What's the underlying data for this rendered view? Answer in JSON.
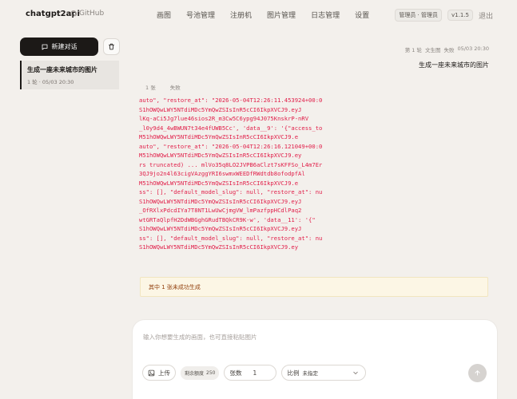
{
  "header": {
    "brand": "chatgpt2api",
    "github": "GitHub",
    "nav": [
      "画图",
      "号池管理",
      "注册机",
      "图片管理",
      "日志管理",
      "设置"
    ],
    "role_badge": "管理员 · 管理员",
    "version": "v1.1.5",
    "logout": "退出"
  },
  "sidebar": {
    "new_chat": "新建对话",
    "conversations": [
      {
        "title": "生成一座未来城市的图片",
        "meta": "1 轮 · 05/03 20:30"
      }
    ]
  },
  "main": {
    "meta": {
      "round": "第 1 轮",
      "mode": "文生图",
      "status": "失败",
      "time": "05/03 20:30"
    },
    "prompt": "生成一座未来城市的图片",
    "count": "1 张",
    "status": "失败",
    "error_lines": [
      "auto\", \"restore_at\": \"2026-05-04T12:26:11.453924+00:00\", \"",
      "S1hOWQwLWY5NTdiMDc5YmQwZSIsInR5cCI6IkpXVCJ9.eyJ",
      "lKq-aCi5Jg7lue46sios2R_m3Cw5C6ypg94J075KnskrP-nRV",
      "_l0y9d4_4wBWUN7t34e4fUWB5Cc', 'data__9': '{\"access_to",
      "M51hOWQwLWY5NTdiMDc5YmQwZSIsInR5cCI6IkpXVCJ9.e",
      "auto\", \"restore_at\": \"2026-05-04T12:26:16.121049+00:00\", \"",
      "M51hOWQwLWY5NTdiMDc5YmQwZSIsInR5cCI6IkpXVCJ9.ey",
      "rs truncated) ... mlVo35q8LO2JVPB6aClzt7sKFFSo_L4m7Er",
      "3QJ9jo2n4l63cigVAzggYRI6swmxWEEDfRWdtdb8ofodpfAl",
      "M51hOWQwLWY5NTdiMDc5YmQwZSIsInR5cCI6IkpXVCJ9.e",
      "ss\": [], \"default_model_slug\": null, \"restore_at\": null, \"succe",
      "S1hOWQwLWY5NTdiMDc5YmQwZSIsInR5cCI6IkpXVCJ9.eyJ",
      "_OfRXlxPdcdIYa7T8NT1LwUwCjmgVW_lmPazfppHCdlPaq2",
      "wtGRTaQlpfH2DdWBGghGRudTBQkCR9K-w', 'data__11': '{\"",
      "S1hOWQwLWY5NTdiMDc5YmQwZSIsInR5cCI6IkpXVCJ9.eyJ",
      "ss\": [], \"default_model_slug\": null, \"restore_at\": null, \"succe",
      "S1hOWQwLWY5NTdiMDc5YmQwZSIsInR5cCI6IkpXVCJ9.ey"
    ],
    "notice": "其中 1 张未成功生成"
  },
  "composer": {
    "placeholder": "输入你想要生成的画面，也可直接粘贴图片",
    "upload": "上传",
    "quota_label": "剩余额度",
    "quota_value": "250",
    "count_label": "张数",
    "count_value": "1",
    "ratio_label": "比例",
    "ratio_value": "未指定"
  }
}
